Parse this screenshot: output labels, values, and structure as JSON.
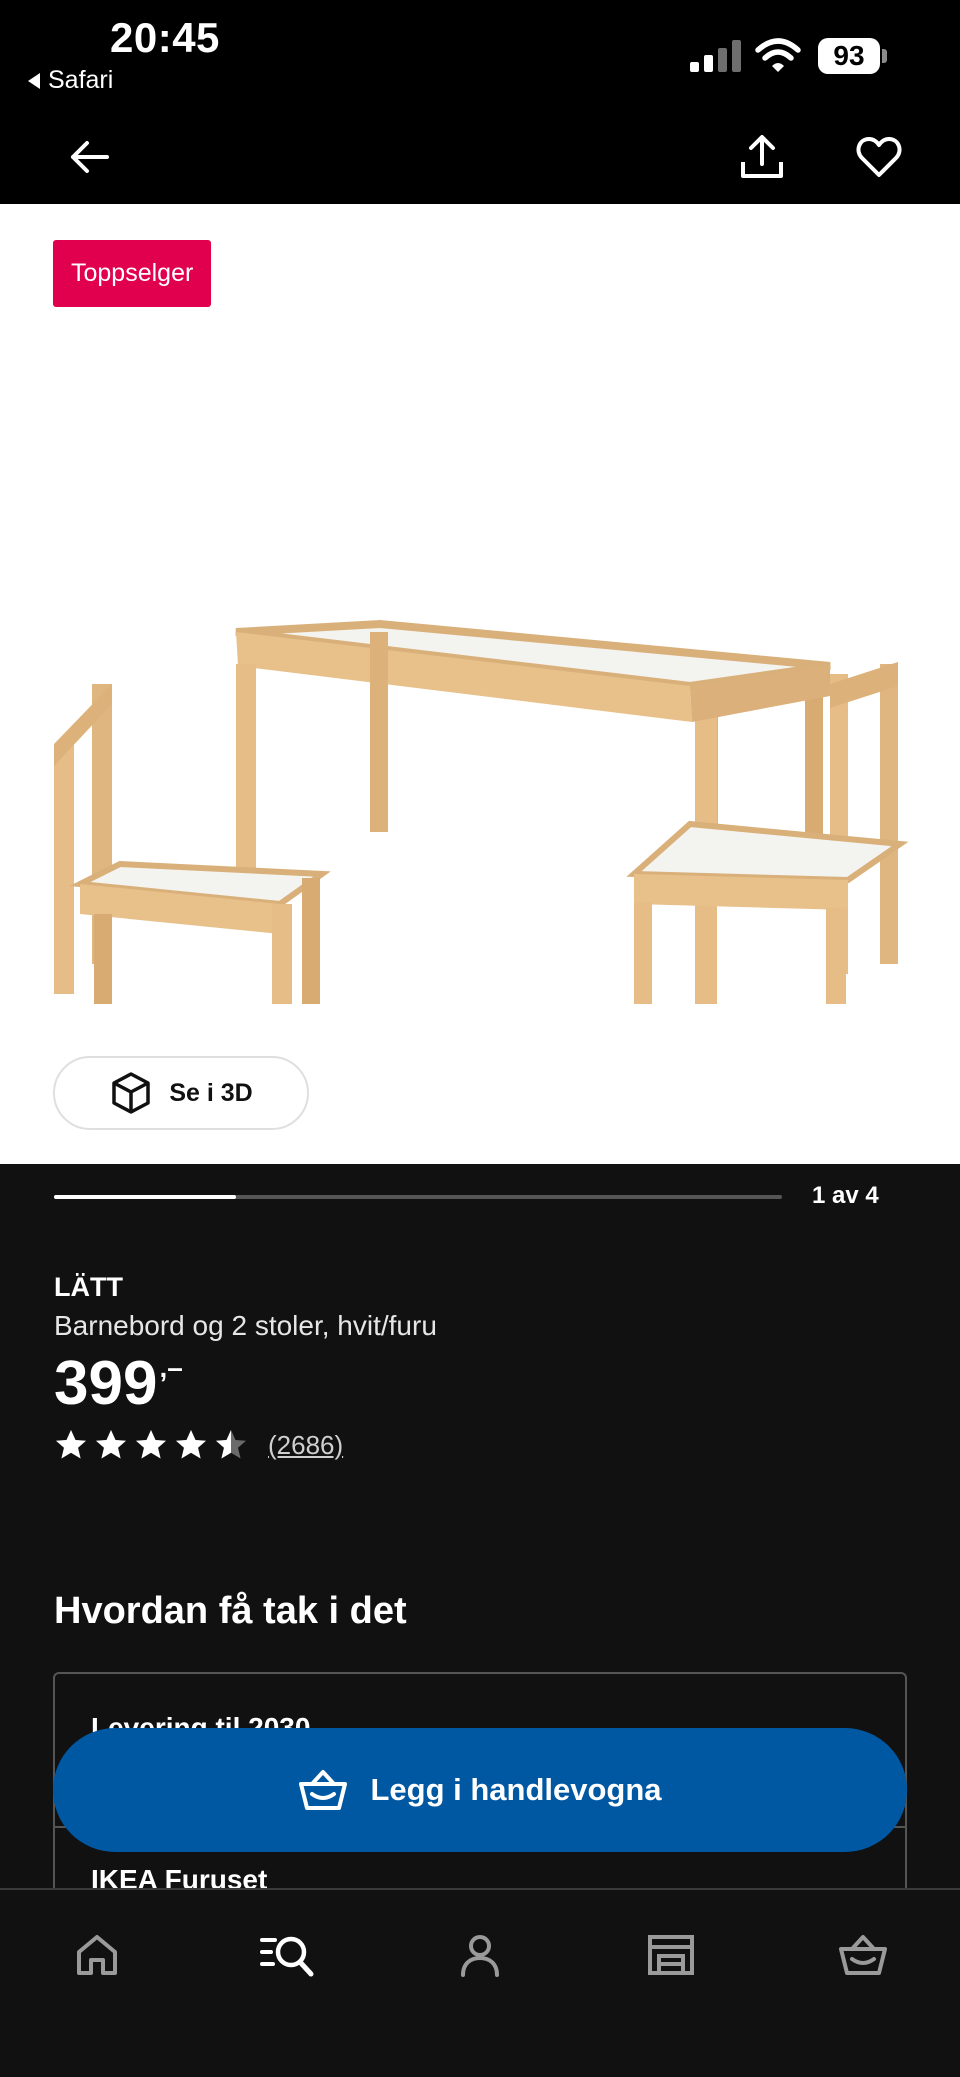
{
  "status_bar": {
    "time": "20:45",
    "back_app": "Safari",
    "battery": "93"
  },
  "app_bar": {
    "icons": [
      "arrow-left-icon",
      "share-icon",
      "heart-icon"
    ]
  },
  "product": {
    "badge": "Toppselger",
    "view3d_label": "Se i 3D",
    "carousel_counter": "1 av 4",
    "carousel_progress": 0.25,
    "brand": "LÄTT",
    "description": "Barnebord og 2 stoler, hvit/furu",
    "price": "399",
    "price_suffix": ",–",
    "rating_value": 4.5,
    "rating_max": 5,
    "review_count": "(2686)"
  },
  "availability": {
    "title": "Hvordan få tak i det",
    "delivery_label": "Levering til 2030",
    "store_label": "IKEA Furuset"
  },
  "cart_button": {
    "label": "Legg i handlevogna"
  },
  "bottom_nav": {
    "items": [
      "home-icon",
      "search-icon",
      "profile-icon",
      "store-icon",
      "cart-icon"
    ],
    "active": "search-icon"
  },
  "colors": {
    "badge": "#e0004d",
    "primary_button": "#0058a3",
    "background": "#111111"
  }
}
